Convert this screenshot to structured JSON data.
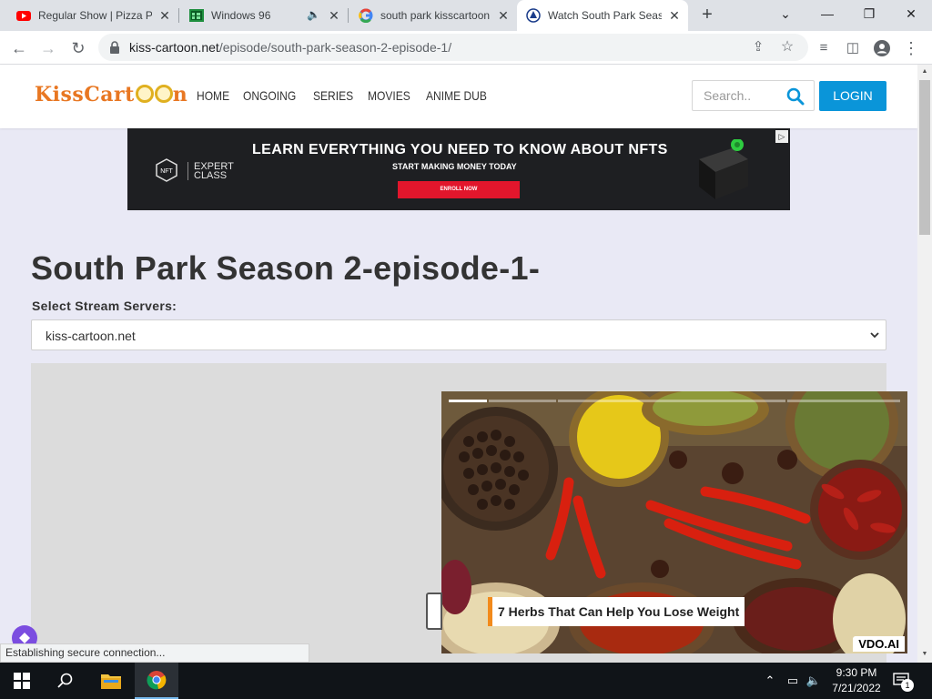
{
  "browser": {
    "tabs": [
      {
        "title": "Regular Show | Pizza Po",
        "icon": "youtube-icon",
        "active": false
      },
      {
        "title": "Windows 96",
        "icon": "windows96-icon",
        "active": false
      },
      {
        "title": "south park kisscartoon",
        "icon": "google-icon",
        "active": false
      },
      {
        "title": "Watch South Park Seas",
        "icon": "kisscartoon-icon",
        "active": true
      }
    ],
    "url_domain": "kiss-cartoon.net",
    "url_path": "/episode/south-park-season-2-episode-1/"
  },
  "site": {
    "logo_text": "KissCart",
    "logo_suffix": "n",
    "nav": [
      "HOME",
      "ONGOING",
      "SERIES",
      "MOVIES",
      "ANIME DUB"
    ],
    "search_placeholder": "Search..",
    "login_label": "LOGIN"
  },
  "ad_banner": {
    "logo": "NFT",
    "brand": "EXPERT CLASS",
    "brand_line1": "EXPERT",
    "brand_line2": "CLASS",
    "headline": "LEARN EVERYTHING YOU NEED TO KNOW ABOUT NFTS",
    "subline": "START MAKING MONEY TODAY",
    "cta": "ENROLL NOW"
  },
  "main": {
    "title": "South Park Season 2-episode-1-",
    "server_label": "Select Stream Servers:",
    "server_selected": "kiss-cartoon.net"
  },
  "video_ad": {
    "caption": "7 Herbs That Can Help You Lose Weight",
    "badge": "VDO.AI",
    "progress": 0.08
  },
  "status_text": "Establishing secure connection...",
  "taskbar": {
    "time": "9:30 PM",
    "date": "7/21/2022",
    "notification_count": "1"
  },
  "colors": {
    "accent_blue": "#0a95d9",
    "logo_orange": "#e87722",
    "ad_cta_red": "#e2162c",
    "caption_bar_orange": "#f28a1b",
    "page_bg": "#e9e9f5"
  }
}
